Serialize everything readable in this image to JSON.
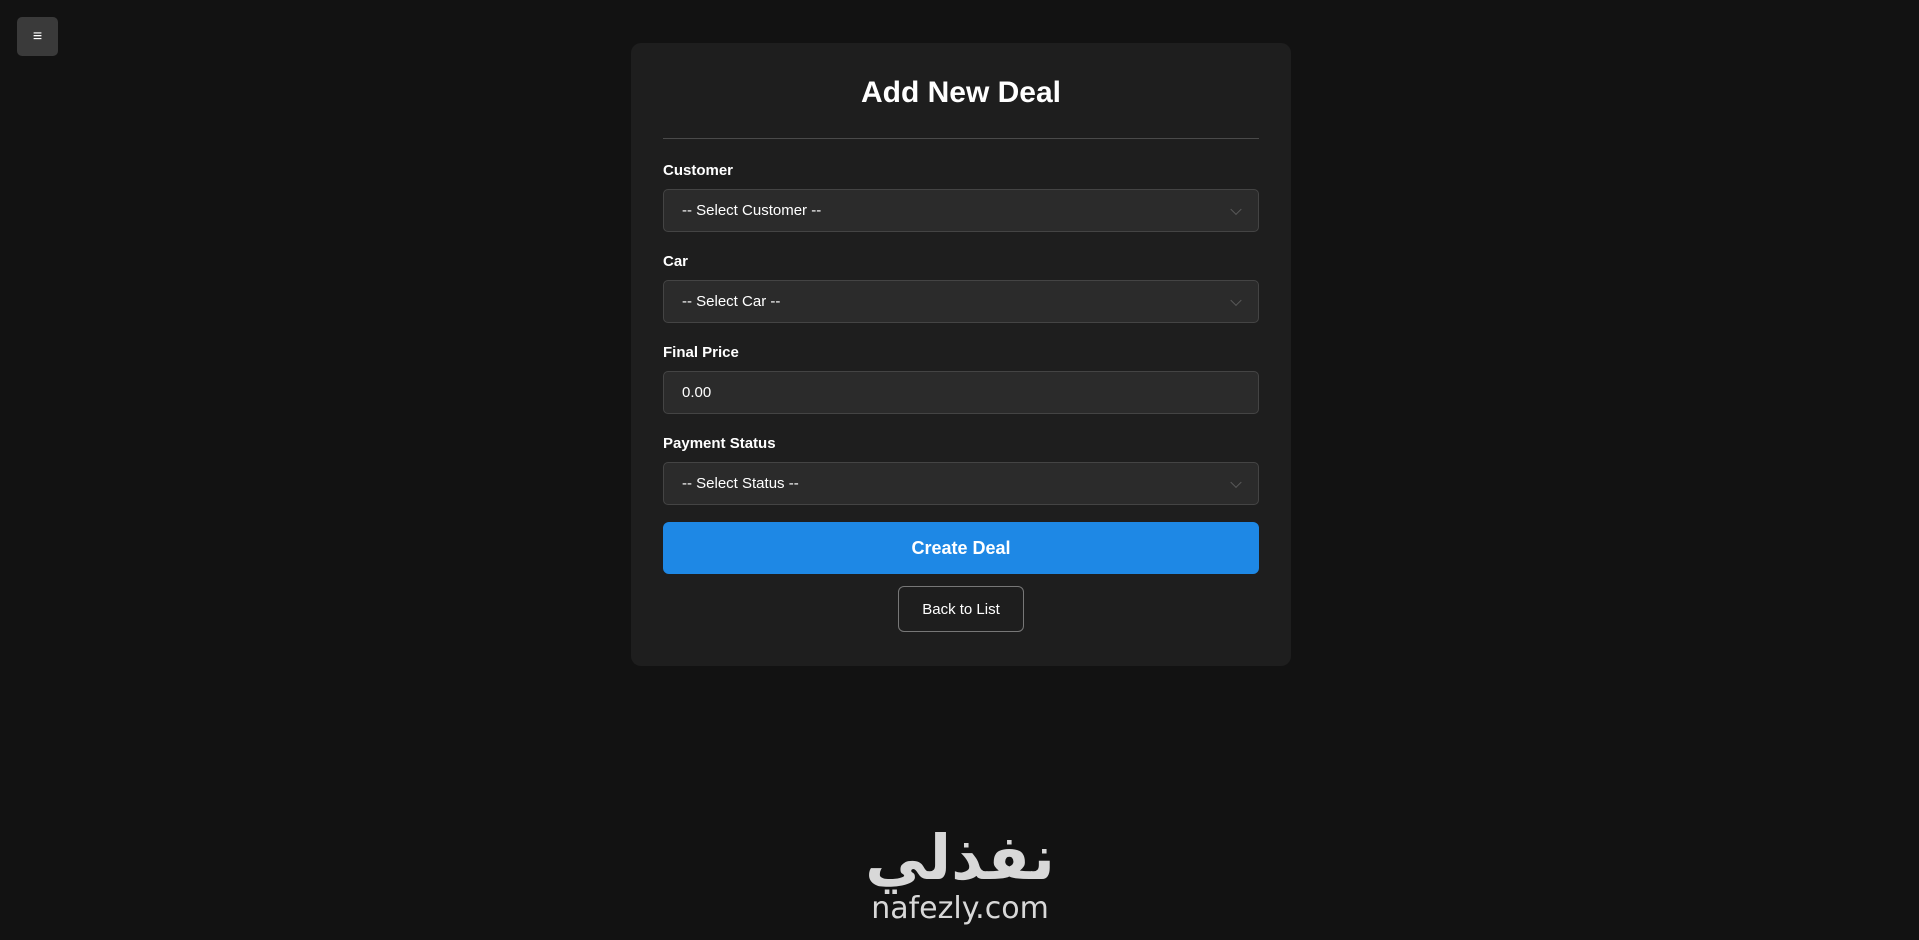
{
  "menu": {
    "icon": "hamburger-icon",
    "glyph": "≡"
  },
  "form": {
    "title": "Add New Deal",
    "fields": {
      "customer": {
        "label": "Customer",
        "value": "-- Select Customer --"
      },
      "car": {
        "label": "Car",
        "value": "-- Select Car --"
      },
      "final_price": {
        "label": "Final Price",
        "value": "0.00"
      },
      "payment_status": {
        "label": "Payment Status",
        "value": "-- Select Status --"
      }
    },
    "submit_label": "Create Deal",
    "back_label": "Back to List"
  },
  "brand": {
    "arabic": "نفذلي",
    "latin": "nafezly.com"
  },
  "colors": {
    "background": "#121212",
    "card": "#1e1e1e",
    "accent": "#1e88e5"
  }
}
